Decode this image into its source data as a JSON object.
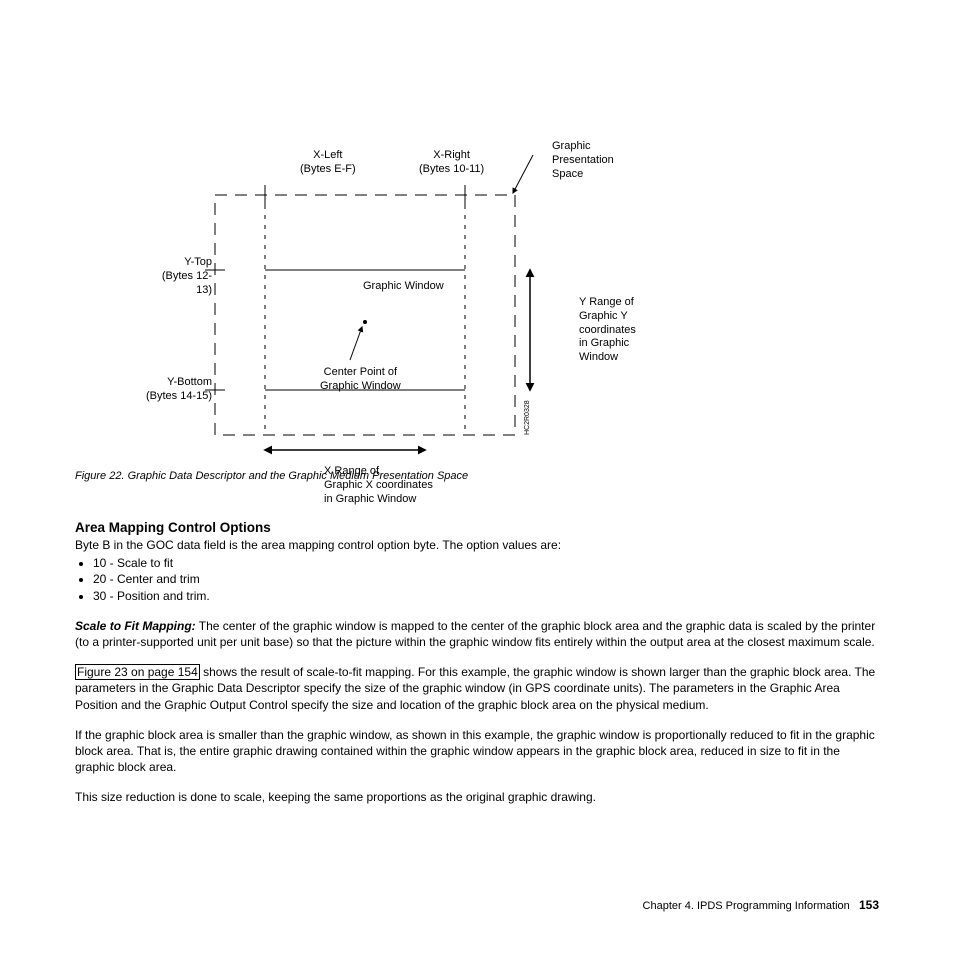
{
  "figure": {
    "xLeft1": "X-Left",
    "xLeft2": "(Bytes E-F)",
    "xRight1": "X-Right",
    "xRight2": "(Bytes 10-11)",
    "gps1": "Graphic",
    "gps2": "Presentation",
    "gps3": "Space",
    "yTop1": "Y-Top",
    "yTop2": "(Bytes 12-13)",
    "yBottom1": "Y-Bottom",
    "yBottom2": "(Bytes 14-15)",
    "gw": "Graphic Window",
    "center1": "Center Point of",
    "center2": "Graphic Window",
    "yRange1": "Y Range of",
    "yRange2": "Graphic Y",
    "yRange3": "coordinates",
    "yRange4": "in Graphic",
    "yRange5": "Window",
    "xRange1": "X Range of",
    "xRange2": "Graphic X coordinates",
    "xRange3": "in Graphic Window",
    "sideCode": "HC2R0328",
    "caption": "Figure 22. Graphic Data Descriptor and the Graphic Medium Presentation Space"
  },
  "heading": "Area Mapping Control Options",
  "intro": "Byte B in the GOC data field is the area mapping control option byte. The option values are:",
  "options": [
    "10 - Scale to fit",
    "20 - Center and trim",
    "30 - Position and trim."
  ],
  "scaleLabel": "Scale to Fit Mapping:",
  "scaleText": " The center of the graphic window is mapped to the center of the graphic block area and the graphic data is scaled by the printer (to a printer-supported unit per unit base) so that the picture within the graphic window fits entirely within the output area at the closest maximum scale.",
  "linkText": "Figure 23 on page 154",
  "para2rest": " shows the result of scale-to-fit mapping. For this example, the graphic window is shown larger than the graphic block area. The parameters in the Graphic Data Descriptor specify the size of the graphic window (in GPS coordinate units). The parameters in the Graphic Area Position and the Graphic Output Control specify the size and location of the graphic block area on the physical medium.",
  "para3": "If the graphic block area is smaller than the graphic window, as shown in this example, the graphic window is proportionally reduced to fit in the graphic block area. That is, the entire graphic drawing contained within the graphic window appears in the graphic block area, reduced in size to fit in the graphic block area.",
  "para4": "This size reduction is done to scale, keeping the same proportions as the original graphic drawing.",
  "footerChapter": "Chapter 4. IPDS Programming Information",
  "pageNum": "153"
}
